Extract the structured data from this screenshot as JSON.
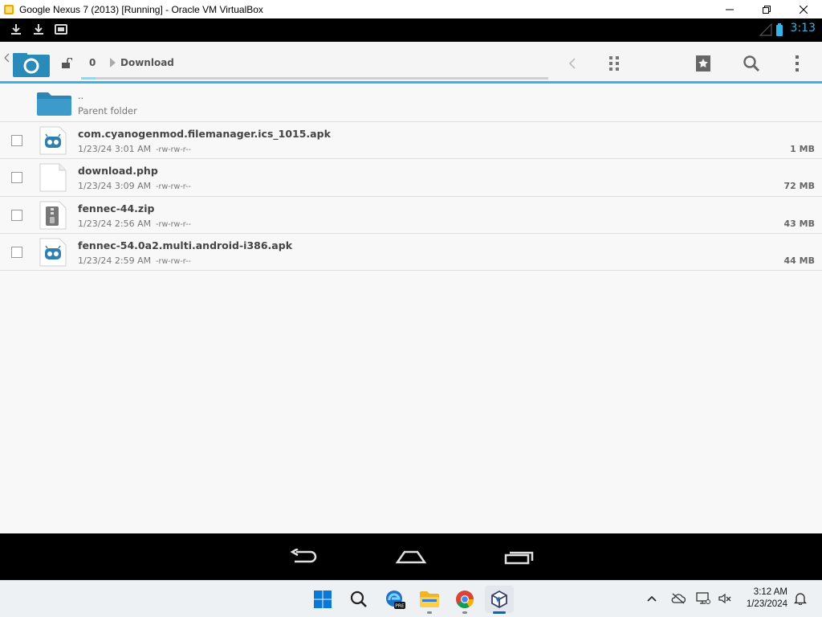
{
  "window": {
    "title": "Google Nexus 7 (2013) [Running] - Oracle VM VirtualBox",
    "controls": [
      "minimize",
      "restore",
      "close"
    ]
  },
  "statusbar": {
    "left_icons": [
      "download-icon",
      "download-icon",
      "screen-icon"
    ],
    "time": "3:13",
    "accent": "#33b5e5"
  },
  "actionbar": {
    "breadcrumb_num": "0",
    "path": "Download",
    "accent": "#33b5e5"
  },
  "list": {
    "parent": {
      "name": "..",
      "label": "Parent folder"
    },
    "files": [
      {
        "name": "com.cyanogenmod.filemanager.ics_1015.apk",
        "date": "1/23/24 3:01 AM",
        "perms": "-rw-rw-r--",
        "size": "1 MB",
        "icon": "apk-icon"
      },
      {
        "name": "download.php",
        "date": "1/23/24 3:09 AM",
        "perms": "-rw-rw-r--",
        "size": "72 MB",
        "icon": "file-icon"
      },
      {
        "name": "fennec-44.zip",
        "date": "1/23/24 2:56 AM",
        "perms": "-rw-rw-r--",
        "size": "43 MB",
        "icon": "zip-icon"
      },
      {
        "name": "fennec-54.0a2.multi.android-i386.apk",
        "date": "1/23/24 2:59 AM",
        "perms": "-rw-rw-r--",
        "size": "44 MB",
        "icon": "apk-icon"
      }
    ]
  },
  "navbar": {
    "buttons": [
      "back",
      "home",
      "recents"
    ]
  },
  "taskbar": {
    "apps": [
      "start",
      "search",
      "edge-beta",
      "file-explorer",
      "chrome",
      "virtualbox"
    ],
    "clock_time": "3:12 AM",
    "clock_date": "1/23/2024"
  }
}
